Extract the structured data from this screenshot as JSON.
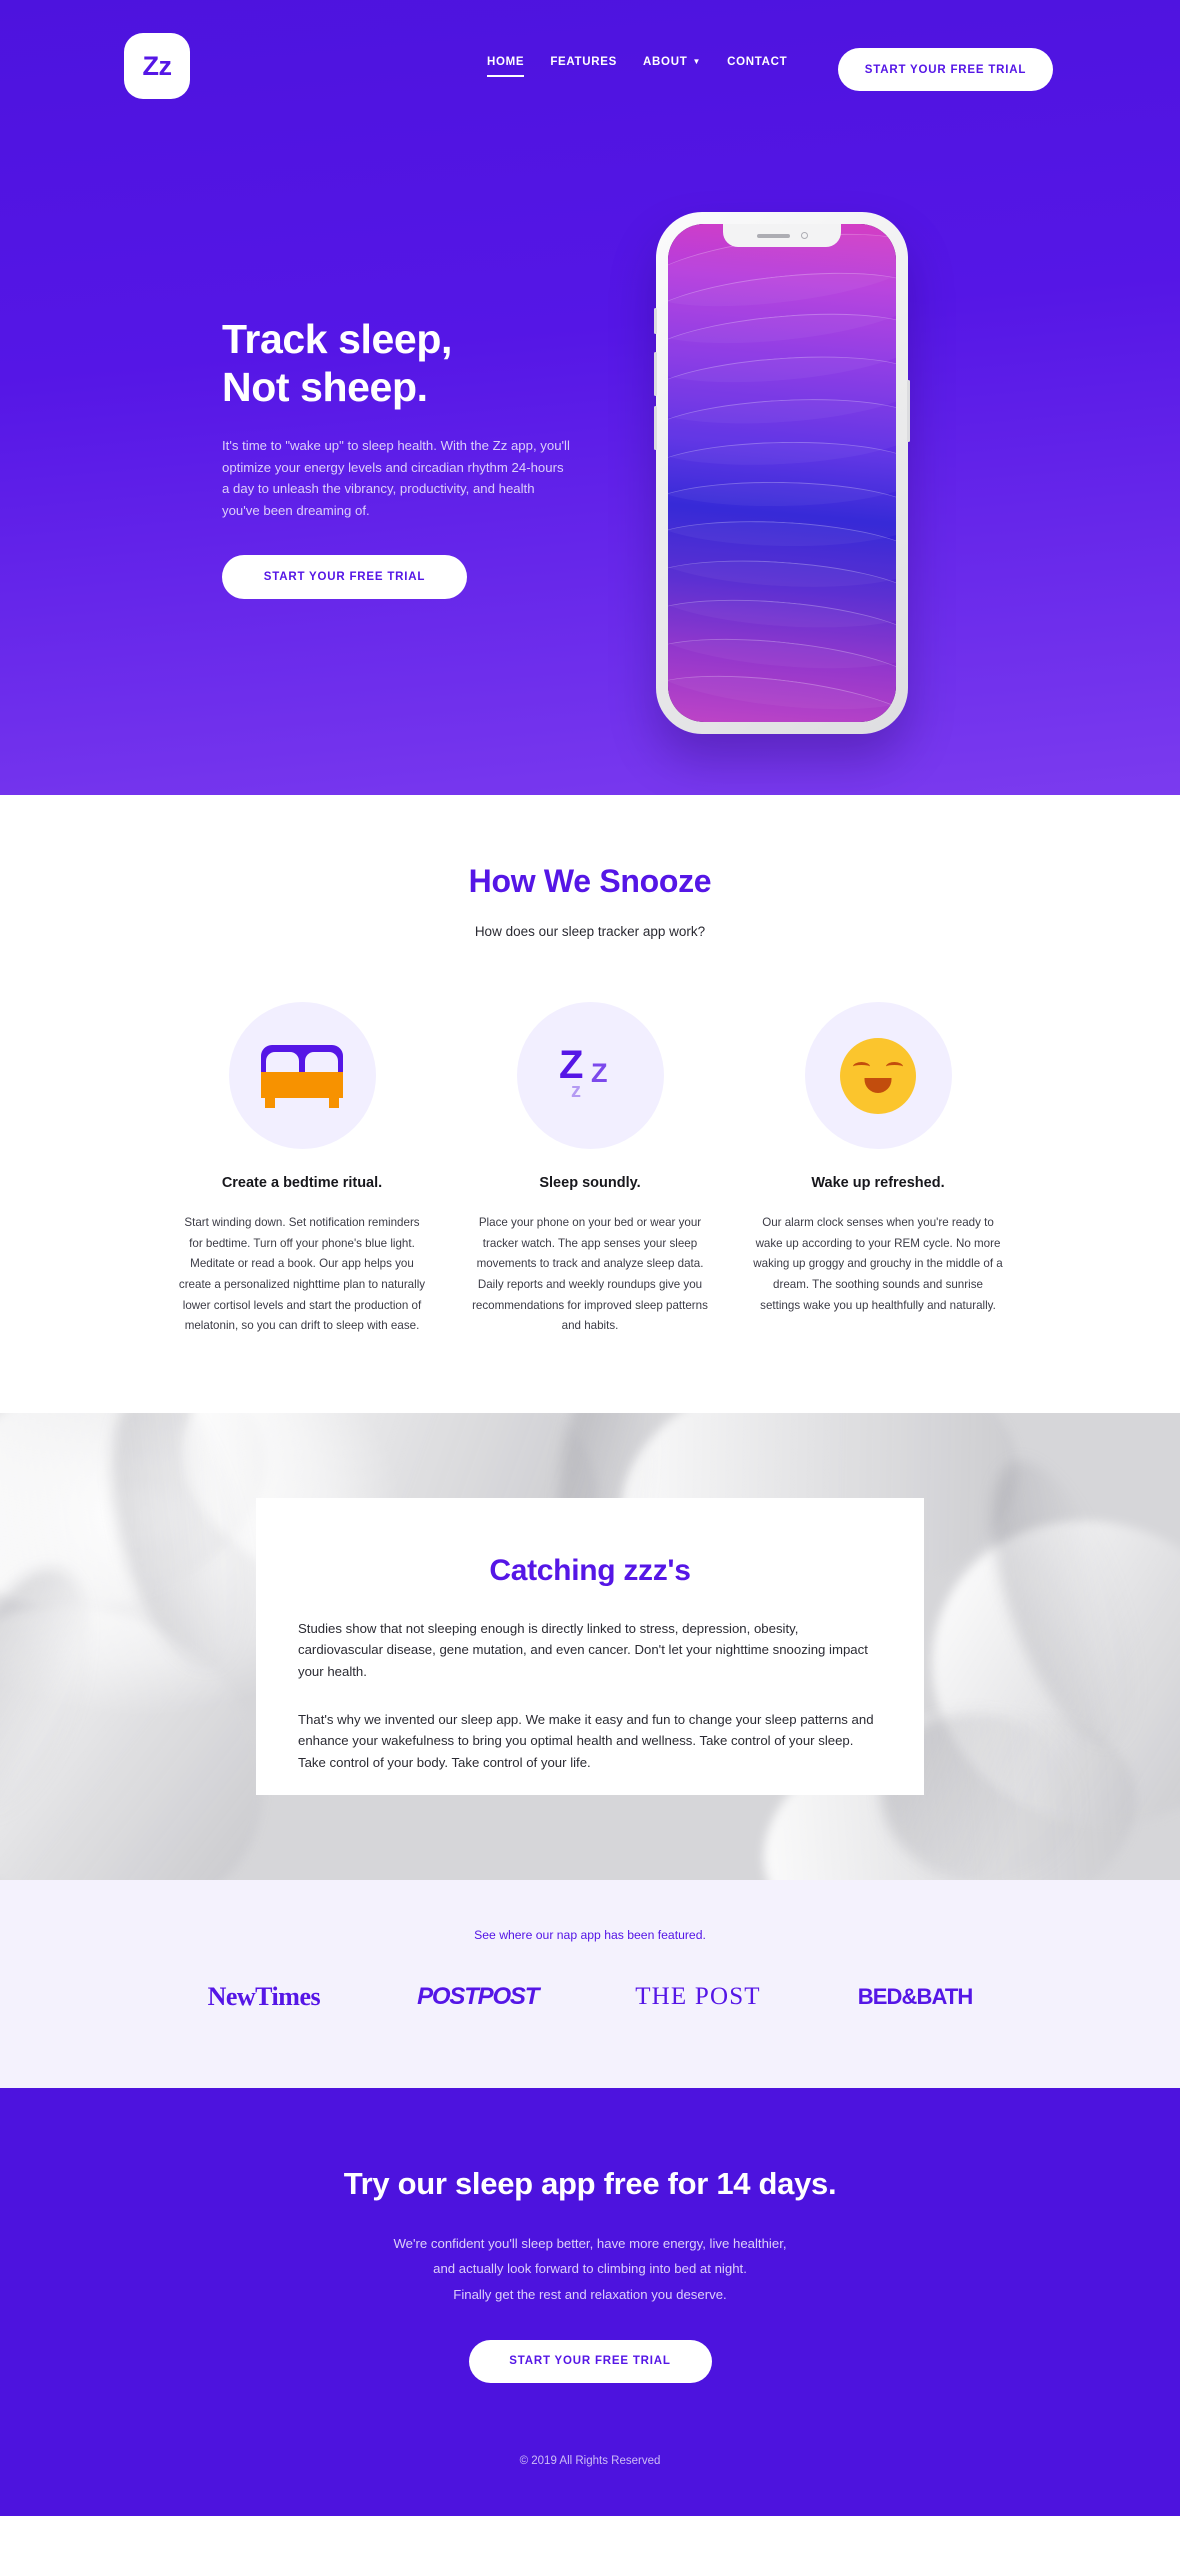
{
  "theme": {
    "brand_purple": "#5516e6",
    "brand_purple_dark": "#4d13de",
    "accent_orange": "#f79200",
    "accent_yellow": "#fbc52d",
    "lavender_bg": "#f4f2fd",
    "icon_circle_bg": "#f2efff"
  },
  "header": {
    "logo_text": "Zz",
    "nav": [
      {
        "label": "HOME",
        "active": true,
        "has_caret": false
      },
      {
        "label": "FEATURES",
        "active": false,
        "has_caret": false
      },
      {
        "label": "ABOUT",
        "active": false,
        "has_caret": true
      },
      {
        "label": "CONTACT",
        "active": false,
        "has_caret": false
      }
    ],
    "cta_label": "START YOUR FREE TRIAL"
  },
  "hero": {
    "title_line1": "Track sleep,",
    "title_line2": "Not sheep.",
    "paragraph": "It's time to \"wake up\" to sleep health. With the Zz app, you'll optimize your energy levels and circadian rhythm 24-hours a day to unleash the vibrancy, productivity, and health you've been dreaming of.",
    "cta_label": "START YOUR FREE TRIAL"
  },
  "snooze": {
    "title": "How We Snooze",
    "subtitle": "How does our sleep tracker app work?",
    "cards": [
      {
        "icon": "bed-icon",
        "title": "Create a bedtime ritual.",
        "body": "Start winding down. Set notification reminders for bedtime. Turn off your phone's blue light. Meditate or read a book. Our app helps you create a personalized nighttime plan to naturally lower cortisol levels and start the production of melatonin, so you can drift to sleep with ease."
      },
      {
        "icon": "zzz-icon",
        "title": "Sleep soundly.",
        "body": "Place your phone on your bed or wear your tracker watch. The app senses your sleep movements to track and analyze sleep data. Daily reports and weekly roundups give you recommendations for improved sleep patterns and habits."
      },
      {
        "icon": "smiling-face-icon",
        "title": "Wake up refreshed.",
        "body": "Our alarm clock senses when you're ready to wake up according to your REM cycle. No more waking up groggy and grouchy in the middle of a dream. The soothing sounds and sunrise settings wake you up healthfully and naturally."
      }
    ]
  },
  "catching": {
    "title": "Catching zzz's",
    "paragraph1": "Studies show that not sleeping enough is directly linked to stress, depression, obesity, cardiovascular disease, gene mutation, and even cancer. Don't let your nighttime snoozing impact your health.",
    "paragraph2": "That's why we invented our sleep app. We make it easy and fun to change your sleep patterns and enhance your wakefulness to bring you optimal health and wellness. Take control of your sleep. Take control of your body. Take control of your life."
  },
  "press": {
    "label": "See where our nap app has been featured.",
    "logos": [
      {
        "name": "NewTimes"
      },
      {
        "name": "POSTPOST"
      },
      {
        "name": "THE POST"
      },
      {
        "name": "BED&BATH"
      }
    ]
  },
  "cta": {
    "title": "Try our sleep app free for 14 days.",
    "line1": "We're confident you'll sleep better, have more energy, live healthier,",
    "line2": "and actually look forward to climbing into bed at night.",
    "line3": "Finally get the rest and relaxation you deserve.",
    "button_label": "START YOUR FREE TRIAL"
  },
  "footer": {
    "copyright": "© 2019 All Rights Reserved"
  }
}
